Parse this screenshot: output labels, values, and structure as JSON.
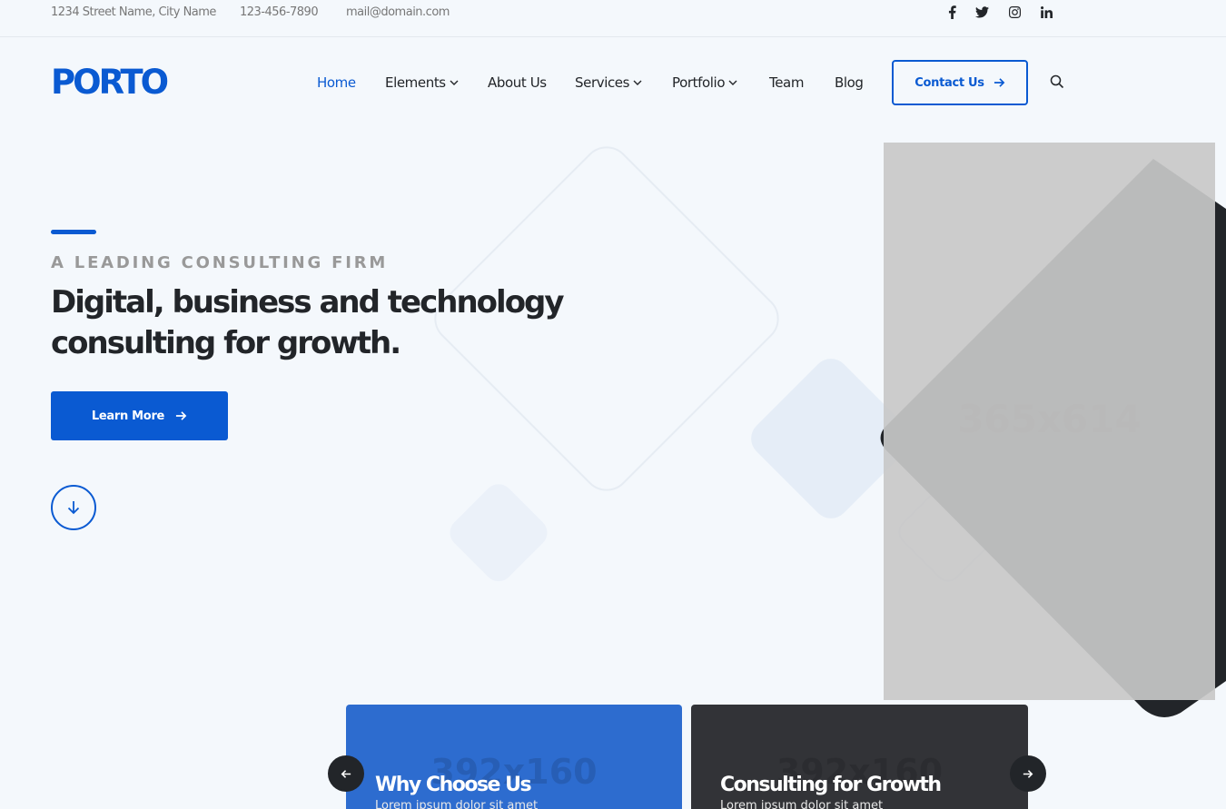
{
  "topbar": {
    "address": "1234 Street Name, City Name",
    "phone": "123-456-7890",
    "email": "mail@domain.com",
    "social_icons": [
      "facebook-icon",
      "twitter-icon",
      "instagram-icon",
      "linkedin-icon"
    ]
  },
  "header": {
    "logo": "PORTO",
    "nav": [
      {
        "label": "Home",
        "active": true,
        "dropdown": false
      },
      {
        "label": "Elements",
        "active": false,
        "dropdown": true
      },
      {
        "label": "About Us",
        "active": false,
        "dropdown": false
      },
      {
        "label": "Services",
        "active": false,
        "dropdown": true
      },
      {
        "label": "Portfolio",
        "active": false,
        "dropdown": true
      },
      {
        "label": "Team",
        "active": false,
        "dropdown": false
      },
      {
        "label": "Blog",
        "active": false,
        "dropdown": false
      }
    ],
    "contact_label": "Contact Us"
  },
  "hero": {
    "eyebrow": "A LEADING CONSULTING FIRM",
    "headline_line1": "Digital, business and technology",
    "headline_line2": "consulting for growth.",
    "cta_label": "Learn More",
    "image_placeholder": "365x614"
  },
  "cards": [
    {
      "title": "Why Choose Us",
      "subtitle": "Lorem ipsum dolor sit amet",
      "placeholder": "392x160"
    },
    {
      "title": "Consulting for Growth",
      "subtitle": "Lorem ipsum dolor sit amet",
      "placeholder": "392x160"
    }
  ],
  "colors": {
    "primary": "#0a5ad2",
    "dark": "#222529",
    "background": "#f4f8fc",
    "card_blue": "#2d6ccf",
    "card_dark": "#323337"
  }
}
